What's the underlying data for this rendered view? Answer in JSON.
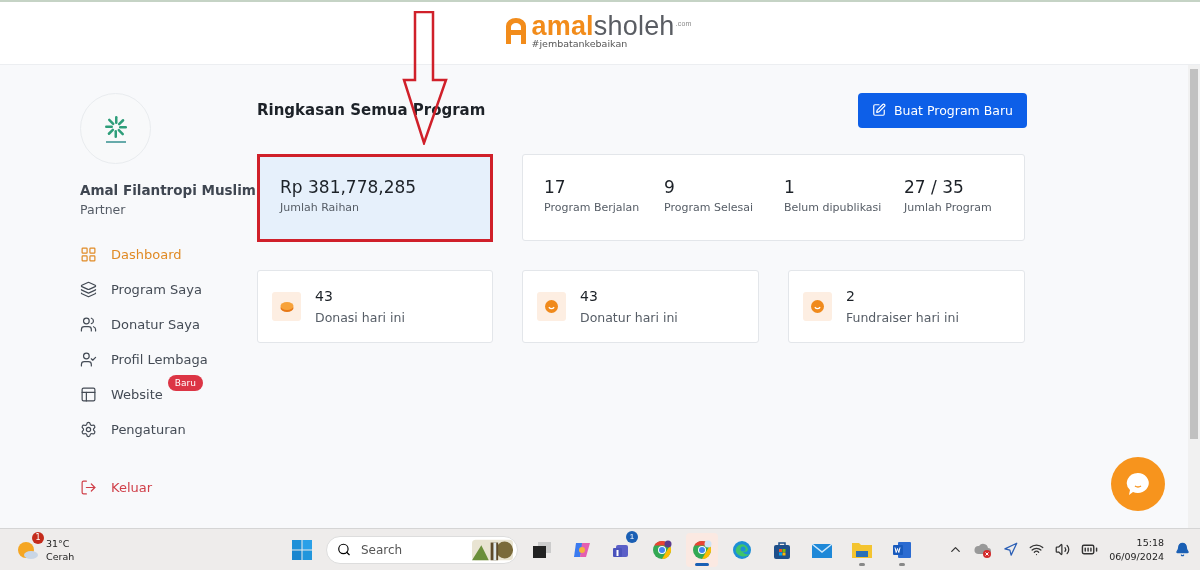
{
  "header": {
    "logo": {
      "brand_first": "amal",
      "brand_second": "sholeh",
      "suffix": ".com",
      "tagline": "#jembatankebaikan"
    }
  },
  "sidebar": {
    "org_name": "Amal Filantropi Muslim",
    "role": "Partner",
    "items": [
      {
        "kind": "dashboard",
        "label": "Dashboard",
        "selected": true
      },
      {
        "kind": "programs",
        "label": "Program Saya",
        "selected": false
      },
      {
        "kind": "donors",
        "label": "Donatur Saya",
        "selected": false
      },
      {
        "kind": "profile",
        "label": "Profil Lembaga",
        "selected": false
      },
      {
        "kind": "website",
        "label": "Website",
        "selected": false,
        "badge": "Baru"
      },
      {
        "kind": "settings",
        "label": "Pengaturan",
        "selected": false
      }
    ],
    "logout": {
      "label": "Keluar"
    }
  },
  "main": {
    "title": "Ringkasan Semua Program",
    "new_button": "Buat Program Baru",
    "total": {
      "value": "Rp 381,778,285",
      "label": "Jumlah Raihan",
      "highlighted": true
    },
    "program_stats": [
      {
        "value": "17",
        "label": "Program Berjalan"
      },
      {
        "value": "9",
        "label": "Program Selesai"
      },
      {
        "value": "1",
        "label": "Belum dipublikasi"
      },
      {
        "value": "27 / 35",
        "label": "Jumlah Program"
      }
    ],
    "today_stats": [
      {
        "kind": "coin",
        "value": "43",
        "label": "Donasi hari ini"
      },
      {
        "kind": "smile",
        "value": "43",
        "label": "Donatur hari ini"
      },
      {
        "kind": "smile",
        "value": "2",
        "label": "Fundraiser hari ini"
      }
    ]
  },
  "taskbar": {
    "weather": {
      "temp": "31°C",
      "condition": "Cerah",
      "badge": "1"
    },
    "search": {
      "placeholder": "Search"
    },
    "apps": [
      {
        "kind": "taskview",
        "open": false,
        "active": false
      },
      {
        "kind": "copilot",
        "open": false,
        "active": false
      },
      {
        "kind": "teams",
        "open": false,
        "active": false,
        "badge": "1"
      },
      {
        "kind": "chrome-profile",
        "open": false,
        "active": false
      },
      {
        "kind": "chrome",
        "open": true,
        "active": true
      },
      {
        "kind": "edge",
        "open": false,
        "active": false
      },
      {
        "kind": "store",
        "open": false,
        "active": false
      },
      {
        "kind": "mail",
        "open": false,
        "active": false
      },
      {
        "kind": "explorer",
        "open": true,
        "active": false
      },
      {
        "kind": "word",
        "open": true,
        "active": false
      }
    ],
    "time": "15:18",
    "date": "06/09/2024"
  }
}
